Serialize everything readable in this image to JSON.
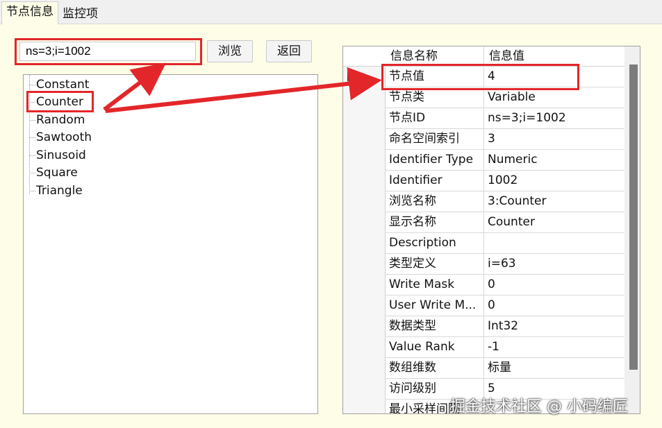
{
  "tabs": {
    "active": "节点信息",
    "inactive": "监控项"
  },
  "search": {
    "value": "ns=3;i=1002"
  },
  "buttons": {
    "browse": "浏览",
    "back": "返回"
  },
  "tree": {
    "items": [
      "Constant",
      "Counter",
      "Random",
      "Sawtooth",
      "Sinusoid",
      "Square",
      "Triangle"
    ]
  },
  "grid": {
    "headers": [
      "信息名称",
      "信息值"
    ],
    "rows": [
      {
        "name": "节点值",
        "value": "4"
      },
      {
        "name": "节点类",
        "value": "Variable"
      },
      {
        "name": "节点ID",
        "value": "ns=3;i=1002"
      },
      {
        "name": "命名空间索引",
        "value": "3"
      },
      {
        "name": "Identifier Type",
        "value": "Numeric"
      },
      {
        "name": "Identifier",
        "value": "1002"
      },
      {
        "name": "浏览名称",
        "value": "3:Counter"
      },
      {
        "name": "显示名称",
        "value": "Counter"
      },
      {
        "name": "Description",
        "value": ""
      },
      {
        "name": "类型定义",
        "value": "i=63"
      },
      {
        "name": "Write Mask",
        "value": "0"
      },
      {
        "name": "User Write M...",
        "value": "0"
      },
      {
        "name": "数据类型",
        "value": "Int32"
      },
      {
        "name": "Value Rank",
        "value": "-1"
      },
      {
        "name": "数组维数",
        "value": "标量"
      },
      {
        "name": "访问级别",
        "value": "5"
      },
      {
        "name": "最小采样间隔",
        "value": ""
      }
    ]
  },
  "watermark": "掘金技术社区 @ 小码编匠",
  "colors": {
    "highlight": "#e3262a",
    "background": "#fefde8"
  }
}
